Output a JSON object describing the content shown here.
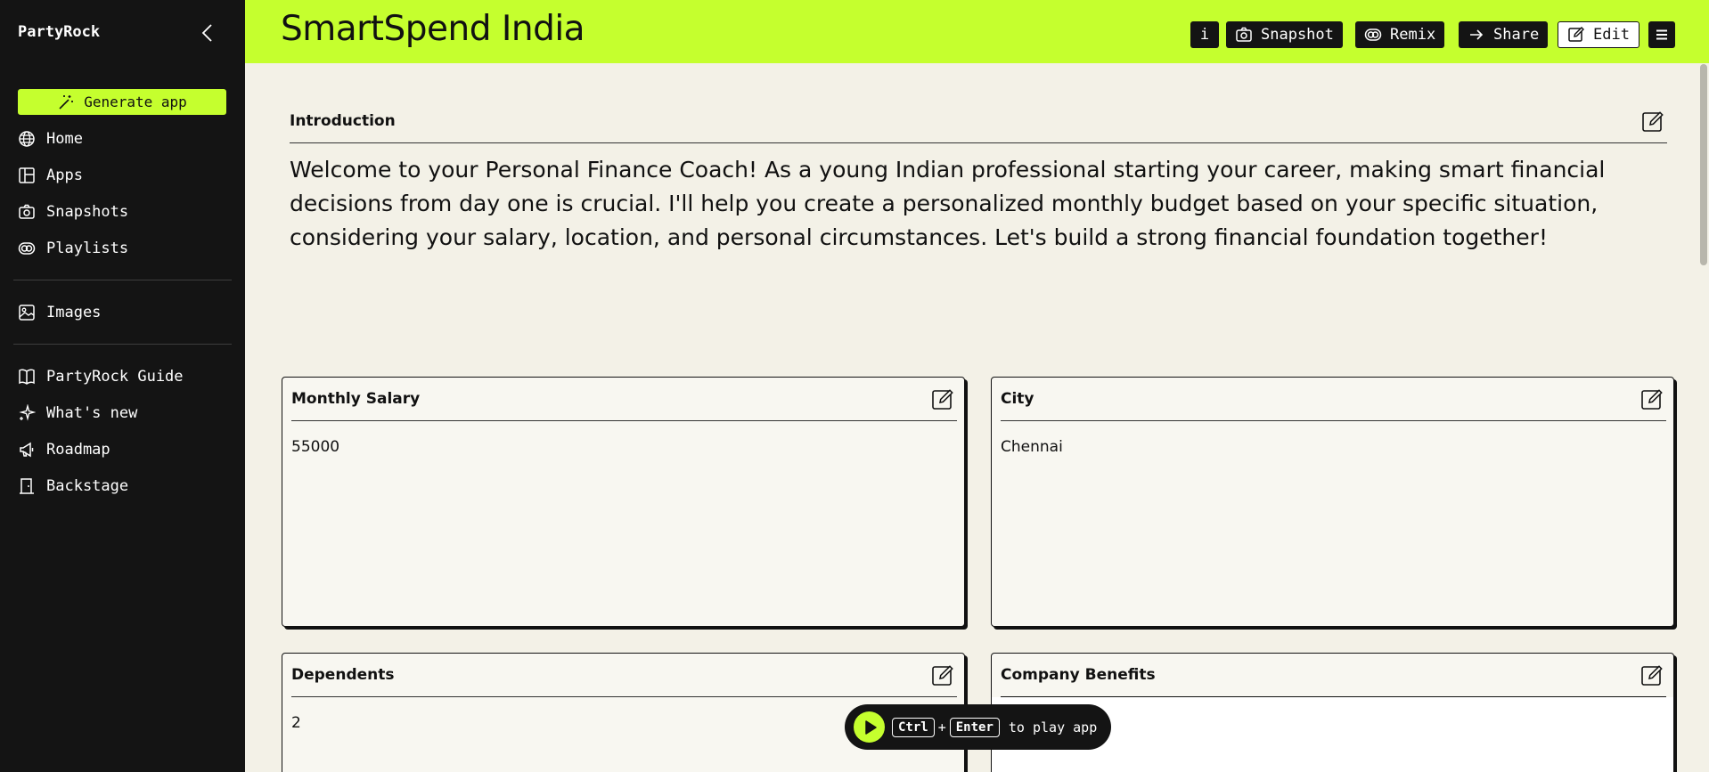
{
  "sidebar": {
    "brand": "PartyRock",
    "generate_label": "Generate app",
    "items": [
      {
        "label": "Home"
      },
      {
        "label": "Apps"
      },
      {
        "label": "Snapshots"
      },
      {
        "label": "Playlists"
      },
      {
        "label": "Images"
      },
      {
        "label": "PartyRock Guide"
      },
      {
        "label": "What's new"
      },
      {
        "label": "Roadmap"
      },
      {
        "label": "Backstage"
      }
    ]
  },
  "header": {
    "title": "SmartSpend India",
    "info_label": "i",
    "snapshot_label": "Snapshot",
    "remix_label": "Remix",
    "share_label": "Share",
    "edit_label": "Edit"
  },
  "intro": {
    "label": "Introduction",
    "text": "Welcome to your Personal Finance Coach! As a young Indian professional starting your career, making smart financial decisions from day one is crucial. I'll help you create a personalized monthly budget based on your specific situation, considering your salary, location, and personal circumstances. Let's build a strong financial foundation together!"
  },
  "widgets": {
    "salary": {
      "title": "Monthly Salary",
      "value": "55000"
    },
    "city": {
      "title": "City",
      "value": "Chennai"
    },
    "dependents": {
      "title": "Dependents",
      "value": "2"
    },
    "benefits": {
      "title": "Company Benefits",
      "value": ""
    }
  },
  "play": {
    "key1": "Ctrl",
    "plus": "+",
    "key2": "Enter",
    "suffix": "to play app"
  },
  "colors": {
    "accent": "#c5ff2e",
    "sidebar_bg": "#141414",
    "page_bg": "#f3f1e7"
  }
}
